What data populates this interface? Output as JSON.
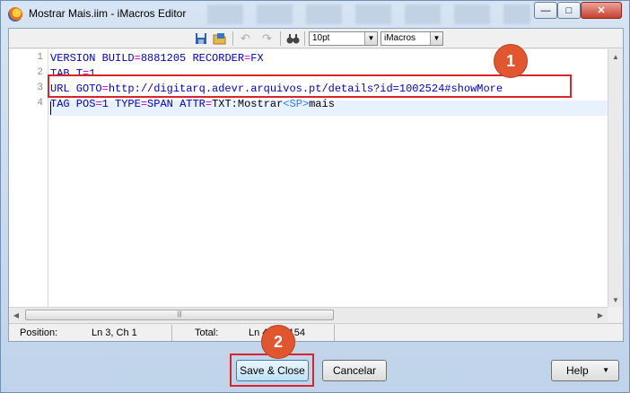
{
  "window": {
    "title": "Mostrar Mais.iim - iMacros Editor",
    "controls": {
      "minimize": "—",
      "maximize": "□",
      "close": "✕"
    }
  },
  "toolbar": {
    "font_size": "10pt",
    "syntax": "iMacros",
    "icons": [
      "save-icon",
      "open-icon",
      "undo-icon",
      "redo-icon",
      "find-icon"
    ]
  },
  "editor": {
    "line_numbers": [
      "1",
      "2",
      "3",
      "4"
    ],
    "lines": [
      [
        {
          "t": "VERSION BUILD",
          "c": "kw"
        },
        {
          "t": "=",
          "c": "op"
        },
        {
          "t": "8881205 ",
          "c": "kw"
        },
        {
          "t": "RECORDER",
          "c": "kw"
        },
        {
          "t": "=",
          "c": "op"
        },
        {
          "t": "FX",
          "c": "kw"
        }
      ],
      [
        {
          "t": "TAB T",
          "c": "kw"
        },
        {
          "t": "=",
          "c": "op"
        },
        {
          "t": "1",
          "c": "kw"
        }
      ],
      [
        {
          "t": "URL GOTO",
          "c": "kw"
        },
        {
          "t": "=",
          "c": "op"
        },
        {
          "t": "http://digitarq.adevr.arquivos.pt/details?id=1002524#showMore",
          "c": "kw"
        }
      ],
      [
        {
          "t": "TAG POS",
          "c": "kw"
        },
        {
          "t": "=",
          "c": "op"
        },
        {
          "t": "1 ",
          "c": "kw"
        },
        {
          "t": "TYPE",
          "c": "kw"
        },
        {
          "t": "=",
          "c": "op"
        },
        {
          "t": "SPAN ",
          "c": "kw"
        },
        {
          "t": "ATTR",
          "c": "kw"
        },
        {
          "t": "=",
          "c": "op"
        },
        {
          "t": "TXT:Mostrar",
          "c": "val"
        },
        {
          "t": "<SP>",
          "c": "sp"
        },
        {
          "t": "mais",
          "c": "val"
        }
      ]
    ]
  },
  "statusbar": {
    "position_label": "Position:",
    "position_value": "Ln 3, Ch 1",
    "total_label": "Total:",
    "total_value": "Ln 4, Ch 154"
  },
  "buttons": {
    "save_close": "Save & Close",
    "cancel": "Cancelar",
    "help": "Help"
  },
  "callouts": {
    "marker1": "1",
    "marker2": "2",
    "color": "#e1562e"
  }
}
